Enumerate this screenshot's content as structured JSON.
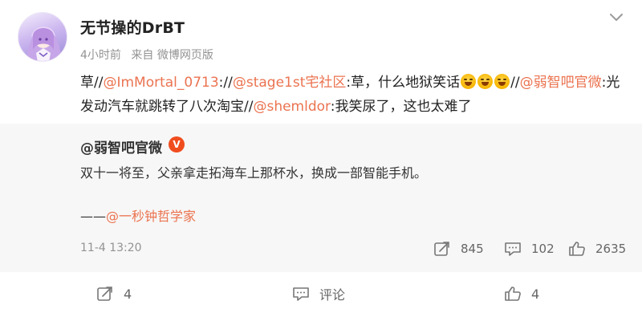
{
  "post": {
    "author": "无节操的DrBT",
    "time": "4小时前",
    "source": "来自 微博网页版",
    "content": {
      "seg1": "草//",
      "mention1": "@ImMortal_0713",
      "seg2": "://",
      "mention2": "@stage1st宅社区",
      "seg3": ":草，什么地狱笑话",
      "seg4": "//",
      "mention3": "@弱智吧官微",
      "seg5": ":光发动汽车就跳转了八次淘宝//",
      "mention4": "@shemldor",
      "seg6": ":我笑尿了，这也太难了"
    },
    "emoji": [
      "laugh-cry-emoji",
      "laugh-cry-emoji",
      "laugh-cry-emoji"
    ]
  },
  "repost": {
    "author": "@弱智吧官微",
    "badge": "V",
    "text": "双十一将至，父亲拿走拓海车上那杯水，换成一部智能手机。",
    "sign_prefix": "——",
    "sign_mention": "@一秒钟哲学家",
    "time": "11-4 13:20",
    "shares": "845",
    "comments": "102",
    "likes": "2635"
  },
  "actions": {
    "share_count": "4",
    "comment_label": "评论",
    "like_count": "4"
  },
  "colors": {
    "mention": "#eb7350",
    "repost_bg": "#f7f7f7",
    "verified_badge": "#f04d1e",
    "meta_text": "#939393"
  },
  "icons": {
    "more": "chevron-down-icon",
    "share": "share-icon",
    "comment": "comment-icon",
    "like": "thumbs-up-icon"
  }
}
